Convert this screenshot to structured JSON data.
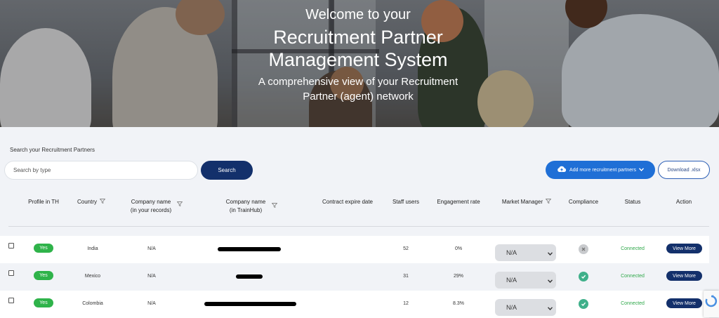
{
  "hero": {
    "kicker": "Welcome to your",
    "title_line1": "Recruitment Partner",
    "title_line2": "Management System",
    "subtitle_line1": "A comprehensive view of your Recruitment",
    "subtitle_line2": "Partner (agent) network"
  },
  "search": {
    "label": "Search your Recruitment Partners",
    "placeholder": "Search by type",
    "button_label": "Search"
  },
  "actions": {
    "add_label": "Add more recruitment partners",
    "add_icon": "cloud-upload-icon",
    "download_label": "Download .xlsx"
  },
  "table": {
    "columns": {
      "profile": "Profile in TH",
      "country": "Country",
      "company_records_1": "Company name",
      "company_records_2": "(in your records)",
      "company_trainhub_1": "Company name",
      "company_trainhub_2": "(in TrainHub)",
      "contract": "Contract expire date",
      "staff": "Staff users",
      "engagement": "Engagement rate",
      "market_manager": "Market Manager",
      "compliance": "Compliance",
      "status": "Status",
      "action": "Action"
    },
    "rows": [
      {
        "profile": "Yes",
        "country": "India",
        "company_records": "N/A",
        "staff": "52",
        "engagement": "0%",
        "market_manager": "N/A",
        "compliance": "not-compliant",
        "status": "Connected",
        "action": "View More"
      },
      {
        "profile": "Yes",
        "country": "Mexico",
        "company_records": "N/A",
        "staff": "31",
        "engagement": "29%",
        "market_manager": "N/A",
        "compliance": "compliant",
        "status": "Connected",
        "action": "View More"
      },
      {
        "profile": "Yes",
        "country": "Colombia",
        "company_records": "N/A",
        "staff": "12",
        "engagement": "8.3%",
        "market_manager": "N/A",
        "compliance": "compliant",
        "status": "Connected",
        "action": "View More"
      }
    ]
  },
  "colors": {
    "primary_navy": "#13306b",
    "accent_blue": "#1f6fd6",
    "yes_green": "#2fb34a",
    "compliant_teal": "#3fb08a",
    "connected_green": "#2fa84a"
  }
}
